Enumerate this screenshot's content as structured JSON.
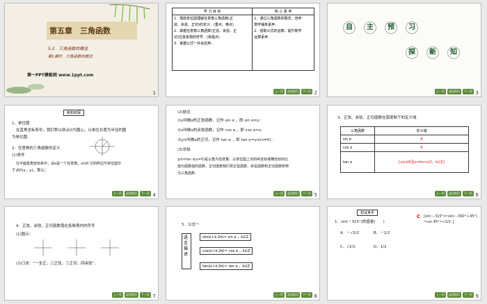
{
  "slides": [
    {
      "number": "1",
      "title": "第五章　三角函数",
      "section": "5.2　三角函数的概念",
      "lesson": "第1课时　三角函数的概念",
      "site": "第一PPT模板网 www.1ppt.com"
    },
    {
      "number": "2",
      "header_left": "学 习 目 标",
      "header_right": "核 心 素 养",
      "left_lines": [
        "1．借助单位圆理解任意角三角函数(正",
        "弦、余弦、正切)的定义．(重点、难点)",
        "2．掌握任意角三角函数(正弦、余弦、正",
        "切)在各象限的符号．(易错点)",
        "3．掌握公式一并会应用．"
      ],
      "right_lines": [
        "1．通过三角函数的概念，培养",
        "数学抽象素养．",
        "2．借助公式的运算，提升数学",
        "运算素养．"
      ]
    },
    {
      "number": "3",
      "chars_top": [
        "自",
        "主",
        "预",
        "习"
      ],
      "chars_bottom": [
        "探",
        "新",
        "知"
      ]
    },
    {
      "number": "4",
      "box": "新知初探",
      "lines": [
        "1．单位圆",
        "在直角坐标系中，我们称以原点O为圆心，以单位长度为半径的圆",
        "为单位圆．",
        "2．任意角的三角函数的定义",
        "(1)条件",
        "在平面直角坐标系中，设α是一个任意角，α∈R 它的终边与单位圆交",
        "于点P(x，y)，那么："
      ]
    },
    {
      "number": "5",
      "lines": [
        "(2)结论",
        "①y叫做α的正弦函数，记作 sin α ，即 sin α=y;",
        "②x叫做α的余弦函数，记作 cos α ，即 cos α=x;",
        "③y/x叫做α的正切，记作 tan α ，即 tan α=y/x(x≠0)．",
        "(3)总结",
        "y/x=tan α(x≠0)是以角为自变量，以单位圆上点的纵坐标或横坐标的比",
        "值为函数值的函数，正切函数我们将正弦函数、余弦函数和正切函数统称",
        "为三角函数．"
      ]
    },
    {
      "number": "6",
      "heading": "3．正弦、余弦、正切函数在弧度制下的定义域",
      "col1": "三角函数",
      "col2": "定义域",
      "rows": [
        [
          "sin α",
          "R"
        ],
        [
          "cos α",
          "R"
        ],
        [
          "tan α",
          "{x|x∈R且x≠kπ+π/2，k∈Z}"
        ]
      ]
    },
    {
      "number": "7",
      "lines": [
        "4．正弦、余弦、正切函数值在各象限内的符号",
        "(1)图示：",
        "(2)口诀：“一全正，二正弦，三正切，四余弦”．"
      ]
    },
    {
      "number": "8",
      "heading": "5．公式一",
      "side": "语言描述",
      "formulas": [
        "sin(α＋k·2π)＝ sin α ，k∈Z",
        "cos(α＋k·2π)＝ cos α ，k∈Z",
        "tan(α＋k·2π)＝ tan α ，k∈Z"
      ]
    },
    {
      "number": "9",
      "box": "初试身手",
      "question": "1．sin(－315°)的值是(　　)",
      "options": [
        "A．－√2/2",
        "B．－1/2",
        "C．√2/2",
        "D．1/2"
      ],
      "answer": "C",
      "explain": "[sin(－315°)＝sin(－360°＋45°)＝sin 45°＝√2/2．]"
    }
  ],
  "nav_labels": [
    "上一页",
    "返回首页",
    "下一页"
  ]
}
